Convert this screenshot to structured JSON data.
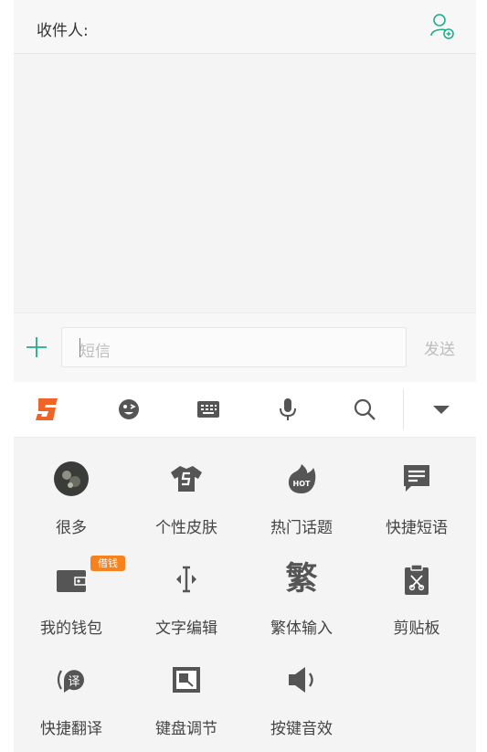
{
  "header": {
    "recipient_label": "收件人:"
  },
  "composer": {
    "sms_placeholder": "短信",
    "send_label": "发送"
  },
  "colors": {
    "accent": "#1fae8a",
    "icon": "#555555",
    "badge": "#f6811d",
    "logo": "#f06428"
  },
  "toolbar": {
    "icons": [
      "sogou-logo-icon",
      "emoji-icon",
      "keyboard-icon",
      "mic-icon",
      "search-icon",
      "collapse-icon"
    ]
  },
  "grid": {
    "items": [
      {
        "label": "很多",
        "icon": "avatar-icon"
      },
      {
        "label": "个性皮肤",
        "icon": "skin-shirt-icon"
      },
      {
        "label": "热门话题",
        "icon": "hot-topic-icon"
      },
      {
        "label": "快捷短语",
        "icon": "quick-phrase-icon"
      },
      {
        "label": "我的钱包",
        "icon": "wallet-icon",
        "badge": "借钱"
      },
      {
        "label": "文字编辑",
        "icon": "text-edit-icon"
      },
      {
        "label": "繁体输入",
        "icon": "traditional-char-icon",
        "glyph": "繁"
      },
      {
        "label": "剪贴板",
        "icon": "clipboard-icon"
      },
      {
        "label": "快捷翻译",
        "icon": "translate-icon",
        "glyph": "译"
      },
      {
        "label": "键盘调节",
        "icon": "keyboard-resize-icon"
      },
      {
        "label": "按键音效",
        "icon": "key-sound-icon"
      }
    ]
  }
}
